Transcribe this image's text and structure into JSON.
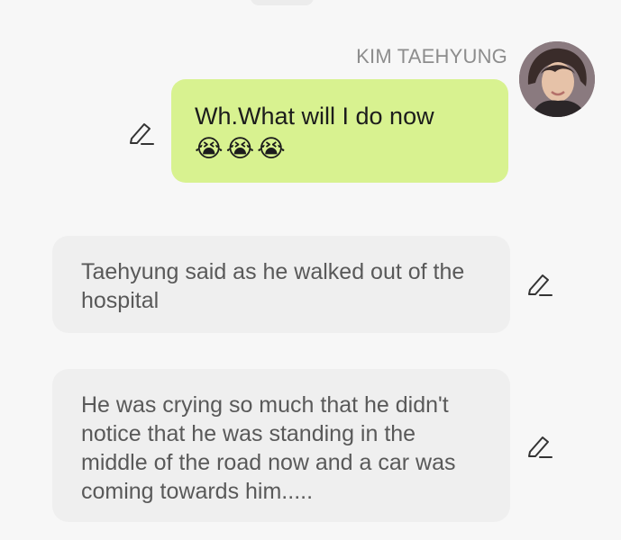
{
  "message": {
    "sender": "KIM TAEHYUNG",
    "text": "Wh.What will I do now",
    "emojis": [
      "😭",
      "😭",
      "😭"
    ]
  },
  "narrations": [
    {
      "text": "Taehyung said as he walked out of the hospital"
    },
    {
      "text": "He was crying so much that he didn't notice that he was standing in the middle of the road now and a car was coming towards him....."
    }
  ],
  "colors": {
    "sent_bubble": "#d8f290",
    "narration_bubble": "#efefef",
    "background": "#f7f7f7",
    "sender_name": "#8d8d8d"
  },
  "icons": {
    "edit": "pencil-icon",
    "emoji": "loudly-crying-face"
  }
}
